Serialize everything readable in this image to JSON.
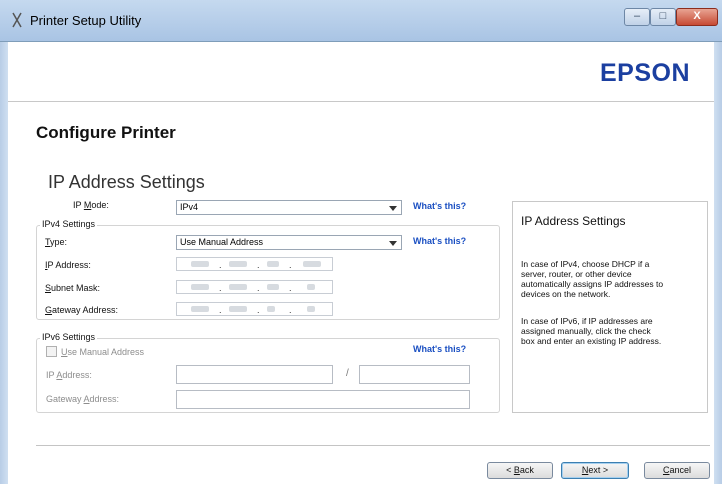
{
  "window": {
    "title": "Printer Setup Utility",
    "min_symbol": "–",
    "max_symbol": "□",
    "close_symbol": "X"
  },
  "brand": {
    "logo_text": "EPSON",
    "logo_color": "#1b3fa0"
  },
  "page": {
    "heading": "Configure Printer",
    "section_title": "IP Address Settings"
  },
  "ip_mode": {
    "label_pre": "IP ",
    "label_accel": "M",
    "label_post": "ode:",
    "value": "IPv4",
    "help_link": "What's this?"
  },
  "ipv4": {
    "group_title": "IPv4 Settings",
    "type_label_accel": "T",
    "type_label_post": "ype:",
    "type_value": "Use Manual Address",
    "type_help_link": "What's this?",
    "ip_label_accel": "I",
    "ip_label_post": "P Address:",
    "subnet_label_accel": "S",
    "subnet_label_post": "ubnet Mask:",
    "gateway_label_accel": "G",
    "gateway_label_post": "ateway Address:",
    "dot": "."
  },
  "ipv6": {
    "group_title": "IPv6 Settings",
    "manual_accel": "U",
    "manual_post": "se Manual Address",
    "help_link": "What's this?",
    "ip_label_pre": "IP ",
    "ip_label_accel": "A",
    "ip_label_post": "ddress:",
    "slash": "/",
    "gateway_label_pre": "Gateway ",
    "gateway_label_accel": "A",
    "gateway_label_post": "ddress:"
  },
  "info": {
    "title": "IP Address Settings",
    "paragraph1": "In case of IPv4, choose DHCP if a\nserver, router, or other device\nautomatically assigns IP addresses to\ndevices on the network.",
    "paragraph2": "In case of IPv6, if IP addresses are\nassigned manually, click the check\nbox and enter an existing IP address."
  },
  "buttons": {
    "back_pre": "< ",
    "back_accel": "B",
    "back_post": "ack",
    "next_accel": "N",
    "next_post": "ext >",
    "cancel_accel": "C",
    "cancel_post": "ancel"
  },
  "colors": {
    "link": "#1a4fc2",
    "title_bar": "#b7cfea",
    "default_button_border": "#3c7fb1"
  }
}
